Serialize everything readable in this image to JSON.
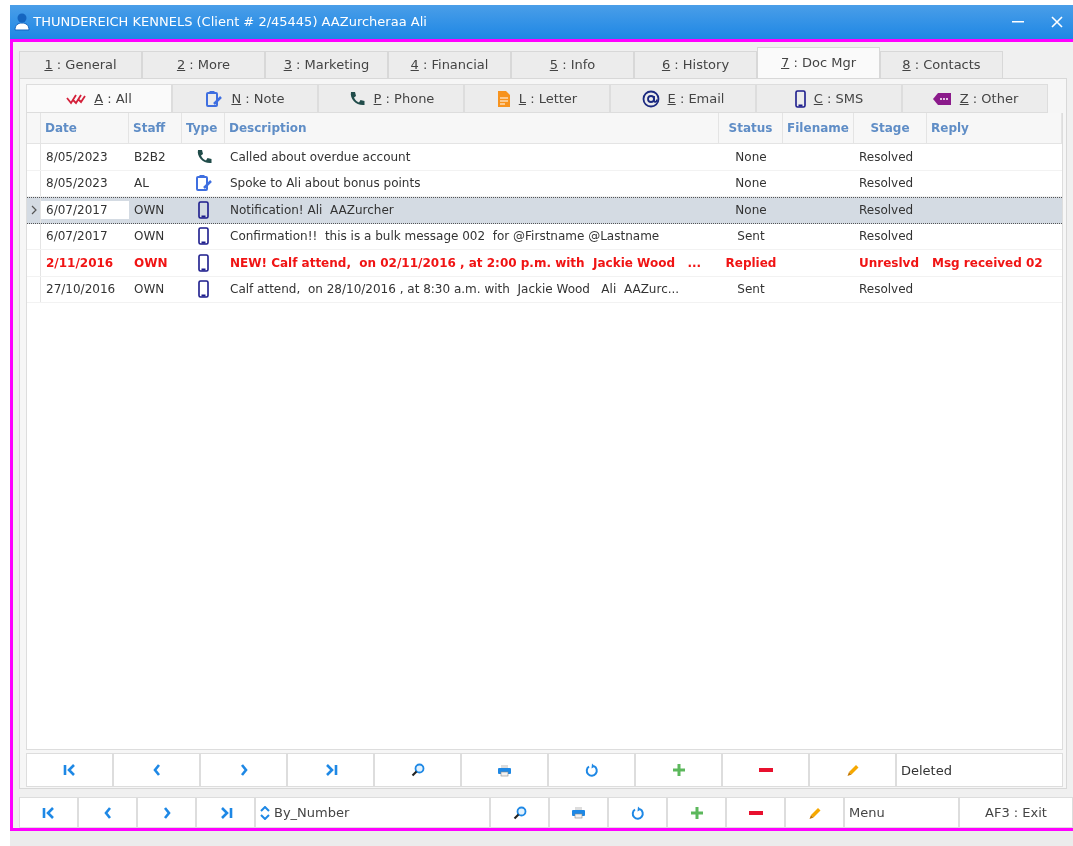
{
  "window": {
    "title": "THUNDEREICH KENNELS (Client # 2/45445) AAZurcheraa Ali"
  },
  "tabs": [
    {
      "label": "1 : General",
      "selected": false
    },
    {
      "label": "2 : More",
      "selected": false
    },
    {
      "label": "3 : Marketing",
      "selected": false
    },
    {
      "label": "4 : Financial",
      "selected": false
    },
    {
      "label": "5 : Info",
      "selected": false
    },
    {
      "label": "6 : History",
      "selected": false
    },
    {
      "label": "7 : Doc Mgr",
      "selected": true
    },
    {
      "label": "8 : Contacts",
      "selected": false
    }
  ],
  "subtabs": [
    {
      "label": "A : All",
      "kind": "all",
      "selected": true
    },
    {
      "label": "N : Note",
      "kind": "note",
      "selected": false
    },
    {
      "label": "P : Phone",
      "kind": "phone",
      "selected": false
    },
    {
      "label": "L : Letter",
      "kind": "letter",
      "selected": false
    },
    {
      "label": "E : Email",
      "kind": "email",
      "selected": false
    },
    {
      "label": "C : SMS",
      "kind": "sms",
      "selected": false
    },
    {
      "label": "Z : Other",
      "kind": "other",
      "selected": false
    }
  ],
  "table": {
    "columns": [
      "Date",
      "Staff",
      "Type",
      "Description",
      "Status",
      "Filename",
      "Stage",
      "Reply"
    ],
    "rows": [
      {
        "date": "8/05/2023",
        "staff": "B2B2",
        "kind": "phone",
        "description": "Called about overdue account",
        "status": "None",
        "stage": "Resolved",
        "unread": false,
        "selected": false
      },
      {
        "date": "8/05/2023",
        "staff": "AL",
        "kind": "note",
        "description": "Spoke to Ali about bonus points",
        "status": "None",
        "stage": "Resolved",
        "unread": false,
        "selected": false
      },
      {
        "date": "6/07/2017",
        "staff": "OWN",
        "kind": "sms",
        "description": "Notification! Ali  AAZurcher",
        "status": "None",
        "stage": "Resolved",
        "unread": false,
        "selected": true
      },
      {
        "date": "6/07/2017",
        "staff": "OWN",
        "kind": "sms",
        "description": "Confirmation!!  this is a bulk message 002  for @Firstname @Lastname",
        "status": "Sent",
        "stage": "Resolved",
        "unread": false,
        "selected": false
      },
      {
        "date": "2/11/2016",
        "staff": "OWN",
        "kind": "sms",
        "description": "NEW! Calf attend,  on 02/11/2016 , at 2:00 p.m. with  Jackie Wood   ...",
        "status": "Replied",
        "stage": "Unreslvd",
        "reply": "Msg received 02",
        "unread": true,
        "selected": false
      },
      {
        "date": "27/10/2016",
        "staff": "OWN",
        "kind": "sms",
        "description": "Calf attend,  on 28/10/2016 , at 8:30 a.m. with  Jackie Wood   Ali  AAZurc...",
        "status": "Sent",
        "stage": "Resolved",
        "unread": false,
        "selected": false
      }
    ]
  },
  "grid_toolbar": {
    "buttons": [
      {
        "kind": "first"
      },
      {
        "kind": "prev"
      },
      {
        "kind": "next"
      },
      {
        "kind": "last"
      },
      {
        "kind": "search"
      },
      {
        "kind": "print"
      },
      {
        "kind": "refresh"
      },
      {
        "kind": "add"
      },
      {
        "kind": "remove"
      },
      {
        "kind": "edit"
      }
    ],
    "status": "Deleted"
  },
  "bottom_toolbar": {
    "nav": [
      {
        "kind": "first"
      },
      {
        "kind": "prev"
      },
      {
        "kind": "next"
      },
      {
        "kind": "last"
      }
    ],
    "sort": "By_Number",
    "actions": [
      {
        "kind": "search"
      },
      {
        "kind": "print"
      },
      {
        "kind": "refresh"
      },
      {
        "kind": "add"
      },
      {
        "kind": "remove"
      },
      {
        "kind": "edit"
      }
    ],
    "menu": "Menu",
    "exit": "AF3 : Exit"
  }
}
